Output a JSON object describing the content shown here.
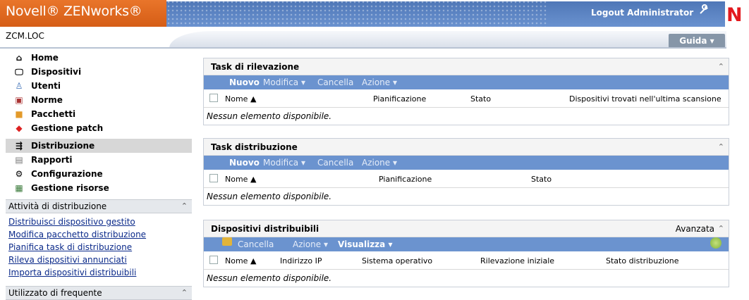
{
  "header": {
    "brand": "Novell® ZENworks®",
    "logout": "Logout Administrator",
    "logo_letter": "N"
  },
  "subheader": {
    "zone": "ZCM.LOC",
    "help": "Guida ▾"
  },
  "nav": {
    "items": [
      {
        "label": "Home",
        "icon": "home-icon"
      },
      {
        "label": "Dispositivi",
        "icon": "monitor-icon"
      },
      {
        "label": "Utenti",
        "icon": "user-icon"
      },
      {
        "label": "Norme",
        "icon": "policy-icon"
      },
      {
        "label": "Pacchetti",
        "icon": "package-icon"
      },
      {
        "label": "Gestione patch",
        "icon": "patch-icon"
      },
      {
        "label": "Distribuzione",
        "icon": "deployment-icon"
      },
      {
        "label": "Rapporti",
        "icon": "report-icon"
      },
      {
        "label": "Configurazione",
        "icon": "configuration-icon"
      },
      {
        "label": "Gestione risorse",
        "icon": "asset-icon"
      }
    ],
    "selected_index": 6
  },
  "deployment_tasks": {
    "title": "Attività di distribuzione",
    "links": [
      "Distribuisci dispositivo gestito",
      "Modifica pacchetto distribuzione",
      "Pianifica task di distribuzione",
      "Rileva dispositivi annunciati",
      "Importa dispositivi distribuibili"
    ]
  },
  "frequent": {
    "title": "Utilizzato di frequente"
  },
  "panels": {
    "discovery": {
      "title": "Task di rilevazione",
      "toolbar": {
        "new": "Nuovo",
        "edit": "Modifica ▾",
        "delete": "Cancella",
        "action": "Azione ▾"
      },
      "columns": [
        "Nome ▲",
        "Pianificazione",
        "Stato",
        "Dispositivi trovati nell'ultima scansione"
      ],
      "empty": "Nessun elemento disponibile."
    },
    "deployment": {
      "title": "Task distribuzione",
      "toolbar": {
        "new": "Nuovo",
        "edit": "Modifica ▾",
        "delete": "Cancella",
        "action": "Azione ▾"
      },
      "columns": [
        "Nome ▲",
        "Pianificazione",
        "Stato"
      ],
      "empty": "Nessun elemento disponibile."
    },
    "deployable": {
      "title": "Dispositivi distribuibili",
      "advanced": "Avanzata",
      "toolbar": {
        "delete": "Cancella",
        "action": "Azione ▾",
        "view": "Visualizza ▾"
      },
      "columns": [
        "Nome ▲",
        "Indirizzo IP",
        "Sistema operativo",
        "Rilevazione iniziale",
        "Stato distribuzione"
      ],
      "empty": "Nessun elemento disponibile."
    }
  },
  "colors": {
    "brand_orange": "#e36a22",
    "header_blue": "#5a82c2",
    "toolbar_blue": "#6b93cf",
    "link_blue": "#0b2a8a",
    "logo_red": "#e3191e"
  }
}
